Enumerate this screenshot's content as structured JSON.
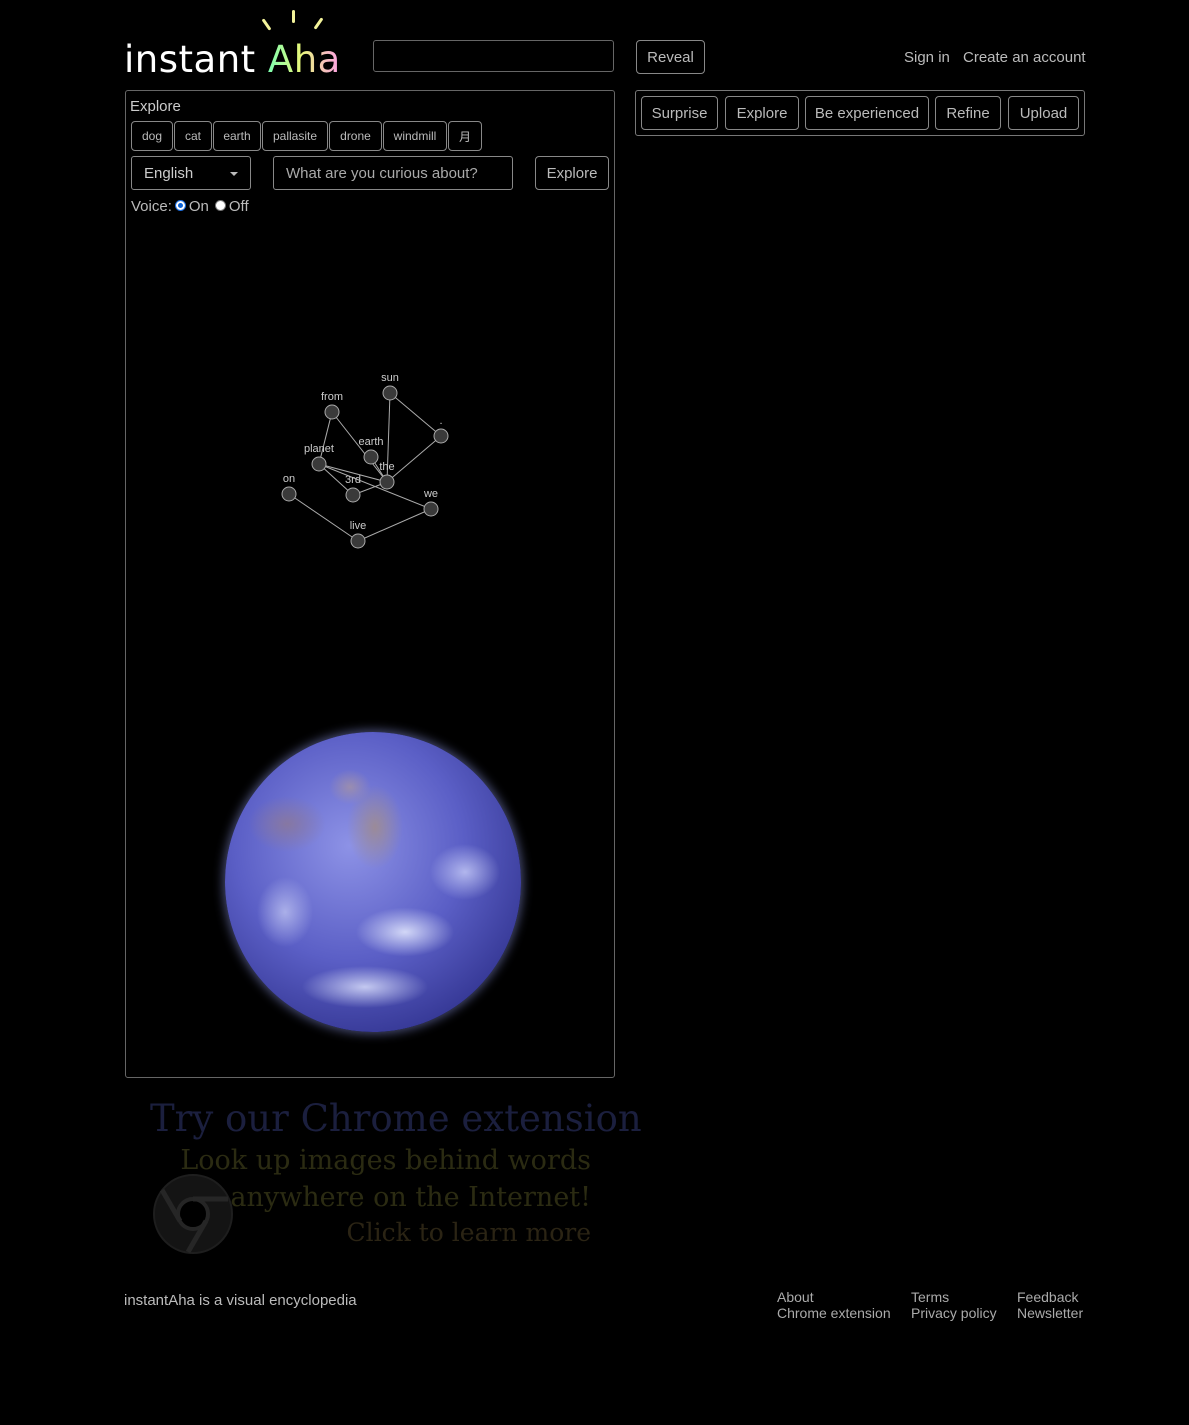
{
  "header": {
    "logo": {
      "part1": "instant",
      "part2": "Aha"
    },
    "search_value": "",
    "reveal_label": "Reveal",
    "sign_in": "Sign in",
    "create_account": "Create an account"
  },
  "explore_panel": {
    "title": "Explore",
    "chips": [
      "dog",
      "cat",
      "earth",
      "pallasite",
      "drone",
      "windmill",
      "月"
    ],
    "language": "English",
    "query_placeholder": "What are you curious about?",
    "explore_button": "Explore",
    "voice": {
      "label": "Voice:",
      "on": "On",
      "off": "Off",
      "selected": "On"
    },
    "word_graph": {
      "words": [
        "sun",
        "from",
        ".",
        "earth",
        "planet",
        "the",
        "on",
        "3rd",
        "we",
        "live"
      ]
    }
  },
  "right_panel": {
    "buttons": [
      "Surprise",
      "Explore",
      "Be experienced",
      "Refine",
      "Upload"
    ]
  },
  "promo": {
    "line1": "Try our Chrome extension",
    "line2": "Look up images behind words",
    "line3": "anywhere on the Internet!",
    "line4": "Click to learn more"
  },
  "footer": {
    "tagline": "instantAha is a visual encyclopedia",
    "links": {
      "about": "About",
      "chrome_extension": "Chrome extension",
      "terms": "Terms",
      "privacy_policy": "Privacy policy",
      "feedback": "Feedback",
      "newsletter": "Newsletter"
    }
  },
  "colors": {
    "background": "#000000",
    "text": "#bbbbbb",
    "border": "#888888",
    "radio_accent": "#0b62d6"
  }
}
